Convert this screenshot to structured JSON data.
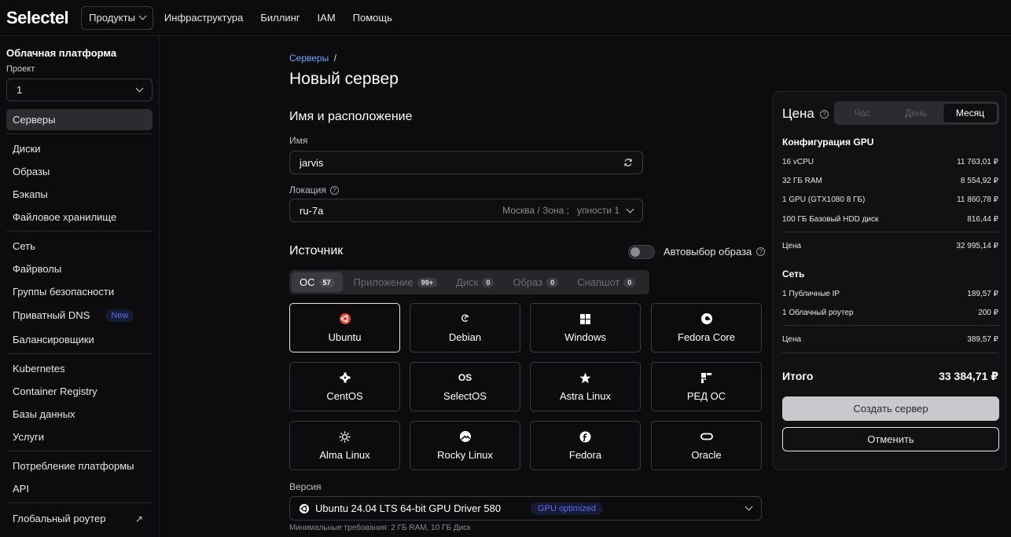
{
  "header": {
    "logo": "Selectel",
    "products": "Продукты",
    "nav": [
      "Инфраструктура",
      "Биллинг",
      "IAM",
      "Помощь"
    ]
  },
  "sidebar": {
    "title": "Облачная платформа",
    "project_label": "Проект",
    "project_value": "1",
    "items": [
      "Серверы",
      "Диски",
      "Образы",
      "Бэкапы",
      "Файловое хранилище",
      "Сеть",
      "Файрволы",
      "Группы безопасности",
      "Приватный DNS",
      "Балансировщики",
      "Kubernetes",
      "Container Registry",
      "Базы данных",
      "Услуги",
      "Потребление платформы",
      "API",
      "Глобальный роутер"
    ],
    "new_badge": "New"
  },
  "main": {
    "breadcrumb_link": "Серверы",
    "breadcrumb_sep": "/",
    "title": "Новый сервер",
    "section_name": "Имя и расположение",
    "name_label": "Имя",
    "name_value": "jarvis",
    "location_label": "Локация",
    "location_value": "ru-7a",
    "location_zone": "Москва / Зона ;",
    "location_pool": "упности 1",
    "source_title": "Источник",
    "auto_image": "Автовыбор образа",
    "tabs": [
      {
        "label": "ОС",
        "count": "57"
      },
      {
        "label": "Приложение",
        "count": "99+"
      },
      {
        "label": "Диск",
        "count": "0"
      },
      {
        "label": "Образ",
        "count": "0"
      },
      {
        "label": "Снапшот",
        "count": "0"
      }
    ],
    "os": [
      {
        "name": "Ubuntu",
        "icon": "ubuntu-icon"
      },
      {
        "name": "Debian",
        "icon": "debian-icon"
      },
      {
        "name": "Windows",
        "icon": "windows-icon"
      },
      {
        "name": "Fedora Core",
        "icon": "fedora-core-icon"
      },
      {
        "name": "CentOS",
        "icon": "centos-icon"
      },
      {
        "name": "SelectOS",
        "icon": "selectos-icon"
      },
      {
        "name": "Astra Linux",
        "icon": "astra-icon"
      },
      {
        "name": "РЕД ОС",
        "icon": "red-os-icon"
      },
      {
        "name": "Alma Linux",
        "icon": "alma-icon"
      },
      {
        "name": "Rocky Linux",
        "icon": "rocky-icon"
      },
      {
        "name": "Fedora",
        "icon": "fedora-icon"
      },
      {
        "name": "Oracle",
        "icon": "oracle-icon"
      }
    ],
    "selectos_glyph": "OS",
    "version_label": "Версия",
    "version_value": "Ubuntu 24.04 LTS 64-bit GPU Driver 580",
    "version_badge": "GPU optimized",
    "requirements": "Минимальные требования: 2 ГБ RAM, 10 ГБ Диск"
  },
  "price": {
    "title": "Цена",
    "periods": [
      "Час",
      "День",
      "Месяц"
    ],
    "gpu_config_title": "Конфигурация GPU",
    "gpu_rows": [
      {
        "label": "16 vCPU",
        "value": "11 763,01 ₽"
      },
      {
        "label": "32 ГБ RAM",
        "value": "8 554,92 ₽"
      },
      {
        "label": "1 GPU (GTX1080 8 ГБ)",
        "value": "11 860,78 ₽"
      },
      {
        "label": "100 ГБ Базовый HDD диск",
        "value": "816,44 ₽"
      }
    ],
    "gpu_sum_label": "Цена",
    "gpu_sum_value": "32 995,14 ₽",
    "net_title": "Сеть",
    "net_rows": [
      {
        "label": "1 Публичные IP",
        "value": "189,57 ₽"
      },
      {
        "label": "1 Облачный роутер",
        "value": "200 ₽"
      }
    ],
    "net_sum_label": "Цена",
    "net_sum_value": "389,57 ₽",
    "total_label": "Итого",
    "total_value": "33 384,71 ₽",
    "create_btn": "Создать сервер",
    "cancel_btn": "Отменить"
  },
  "colors": {
    "accent_link": "#6aa5ff",
    "ubuntu": "#e8412f",
    "badge_blue": "#5b6cf0"
  }
}
